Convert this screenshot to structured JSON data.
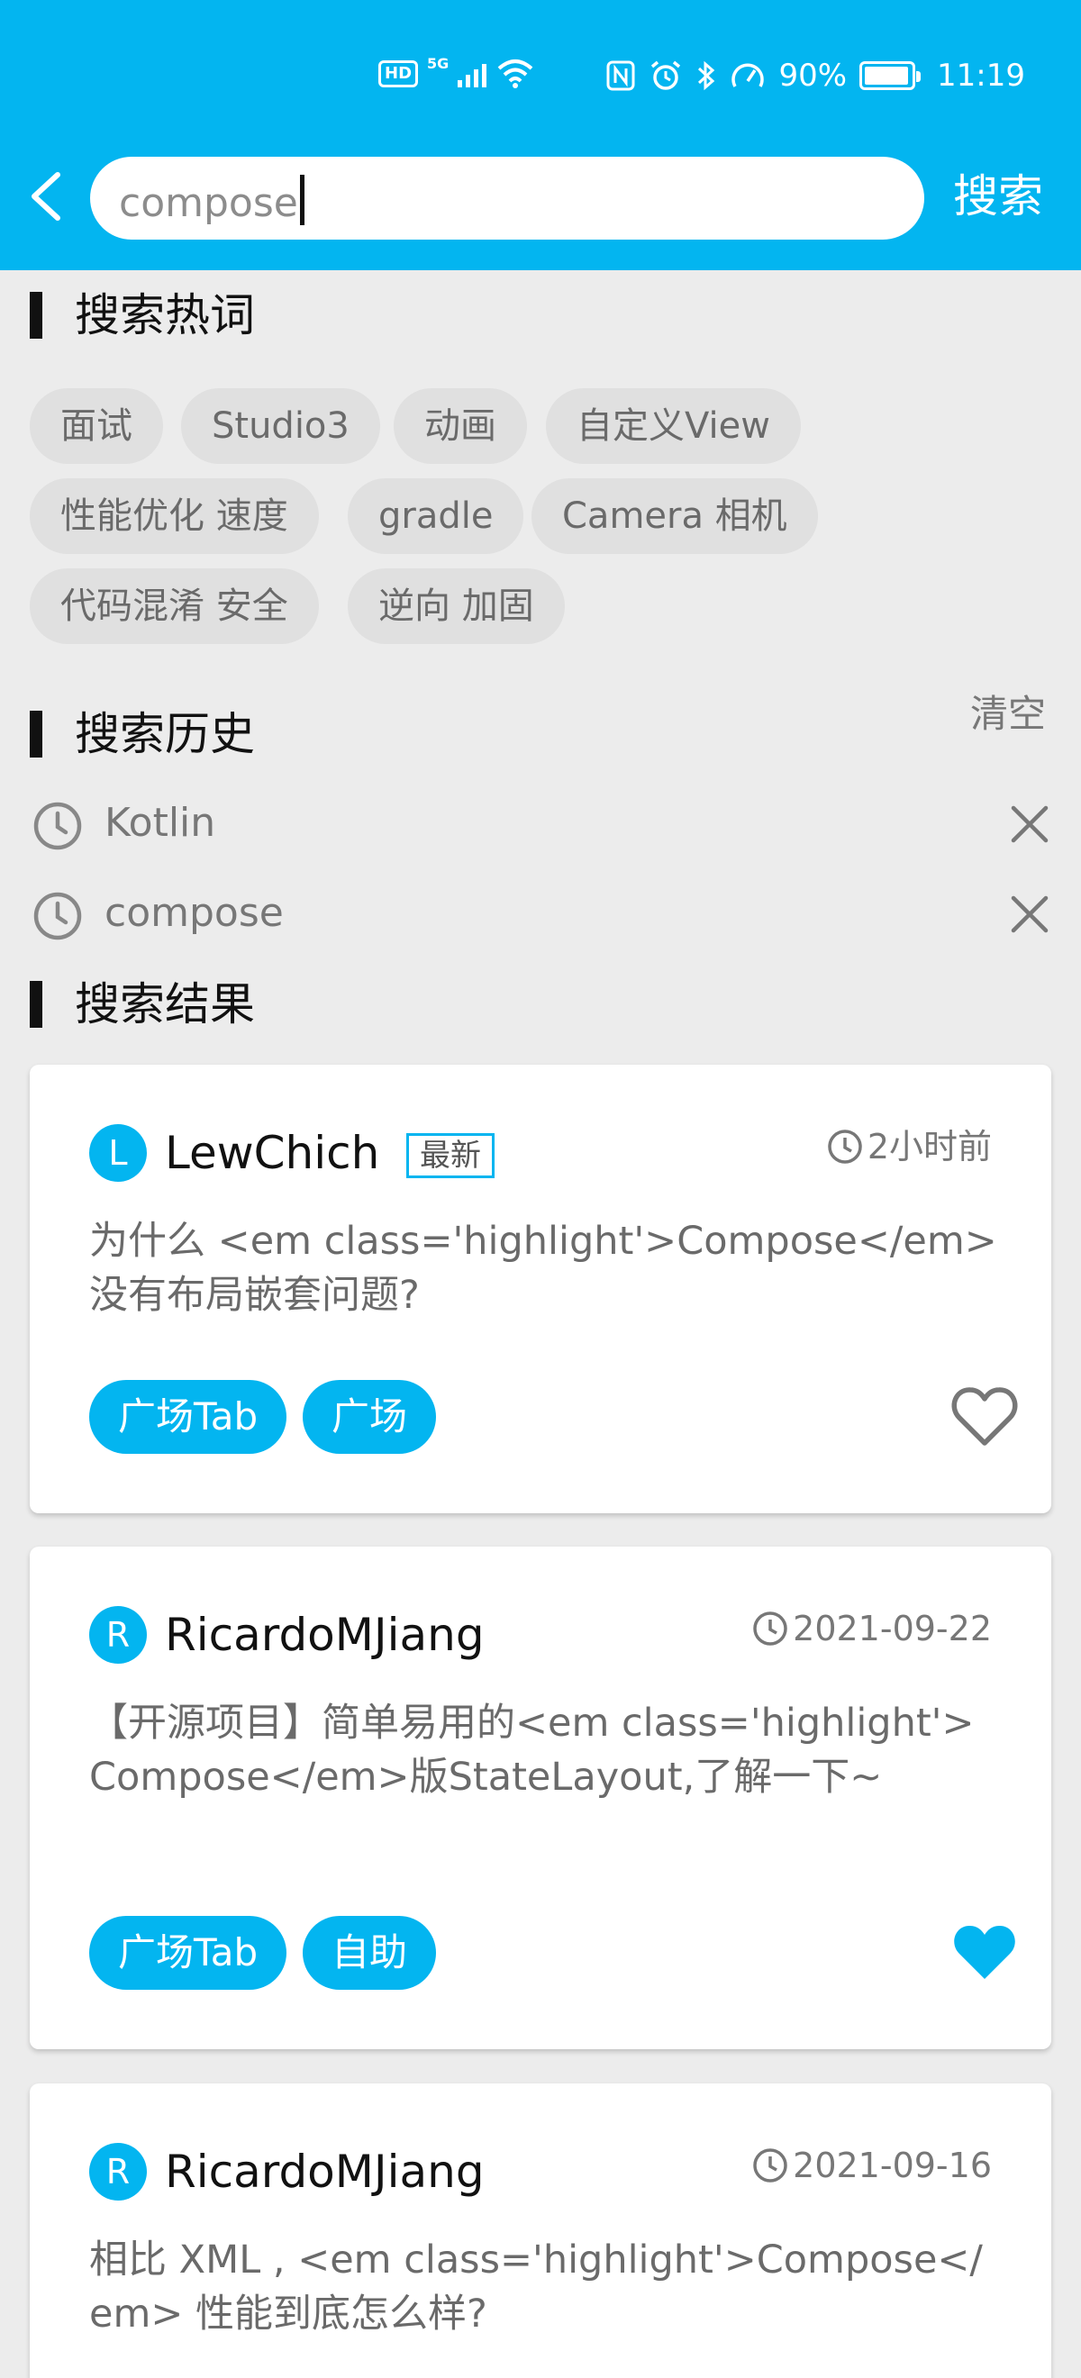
{
  "status_bar": {
    "hd": "HD",
    "network": "5G",
    "battery_percent": "90%",
    "time": "11:19",
    "icons": [
      "hd-icon",
      "signal-icon",
      "wifi-icon",
      "nfc-icon",
      "alarm-icon",
      "bluetooth-icon",
      "speed-icon",
      "battery-icon"
    ]
  },
  "header": {
    "back_icon": "chevron-left-icon",
    "search_value": "compose",
    "search_button": "搜索"
  },
  "hot_words": {
    "title": "搜索热词",
    "chips": [
      "面试",
      "Studio3",
      "动画",
      "自定义View",
      "性能优化 速度",
      "gradle",
      "Camera 相机",
      "代码混淆 安全",
      "逆向 加固"
    ]
  },
  "history": {
    "title": "搜索历史",
    "clear_label": "清空",
    "items": [
      "Kotlin",
      "compose"
    ]
  },
  "results": {
    "title": "搜索结果",
    "items": [
      {
        "avatar": "L",
        "author": "LewChich",
        "badge": "最新",
        "time": "2小时前",
        "title": "为什么 <em class='highlight'>Compose</em> 没有布局嵌套问题?",
        "tags": [
          "广场Tab",
          "广场"
        ],
        "favorited": false
      },
      {
        "avatar": "R",
        "author": "RicardoMJiang",
        "badge": "",
        "time": "2021-09-22",
        "title": "【开源项目】简单易用的<em class='highlight'>Compose</em>版StateLayout,了解一下~",
        "tags": [
          "广场Tab",
          "自助"
        ],
        "favorited": true
      },
      {
        "avatar": "R",
        "author": "RicardoMJiang",
        "badge": "",
        "time": "2021-09-16",
        "title": "相比 XML , <em class='highlight'>Compose</em> 性能到底怎么样?",
        "tags": [],
        "favorited": false
      }
    ]
  },
  "colors": {
    "accent": "#03b5f0",
    "background": "#ececec",
    "chip": "#e0e0e0"
  }
}
